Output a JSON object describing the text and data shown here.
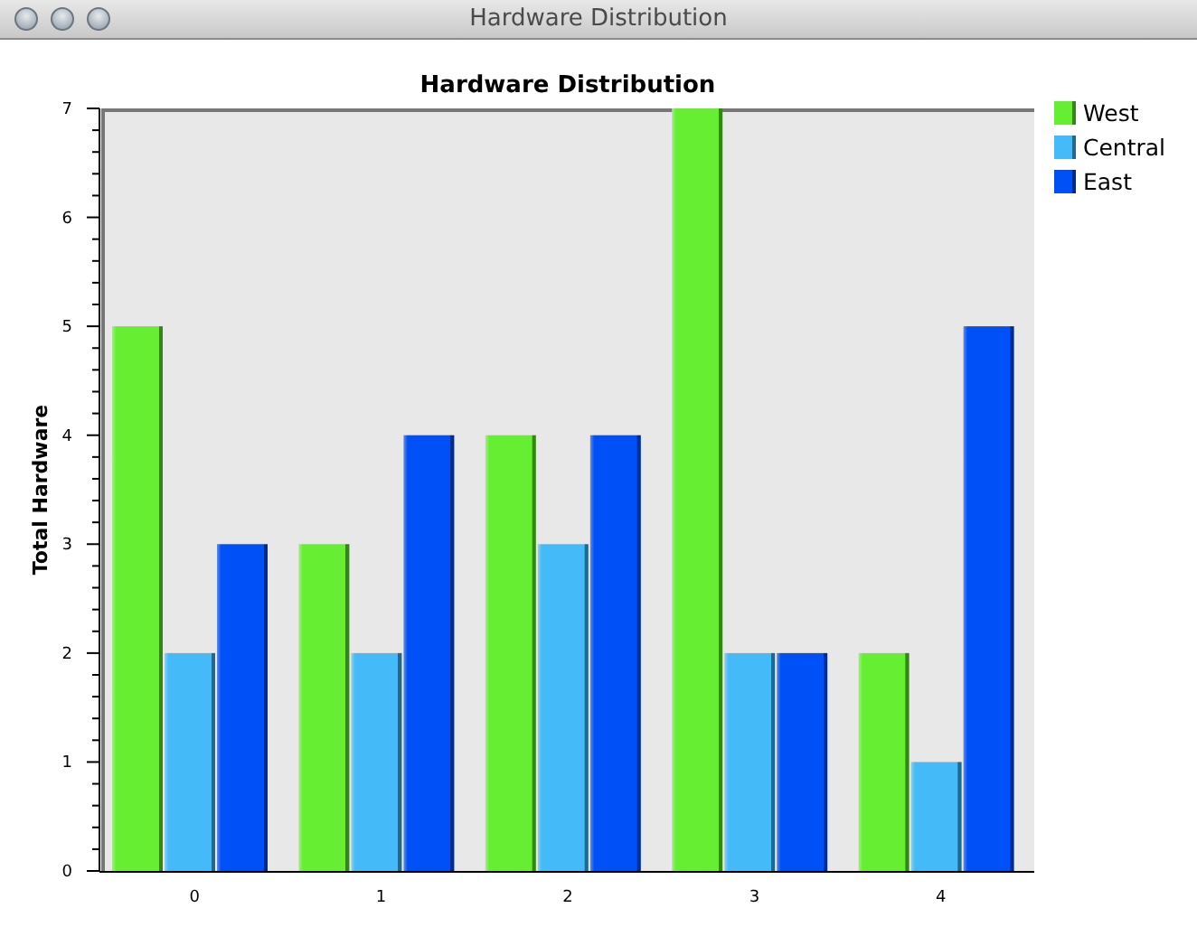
{
  "window": {
    "title": "Hardware Distribution"
  },
  "chart": {
    "chart_data": {
      "type": "bar",
      "title": "Hardware Distribution",
      "ylabel": "Total Hardware",
      "categories": [
        "0",
        "1",
        "2",
        "3",
        "4"
      ],
      "series": [
        {
          "name": "West",
          "color": "#66ee33",
          "values": [
            5,
            3,
            4,
            7,
            2
          ]
        },
        {
          "name": "Central",
          "color": "#44bbf8",
          "values": [
            2,
            2,
            3,
            2,
            1
          ]
        },
        {
          "name": "East",
          "color": "#0050f8",
          "values": [
            3,
            4,
            4,
            2,
            5
          ]
        }
      ],
      "legend": true,
      "ylim": [
        0,
        7
      ],
      "yticks": [
        0,
        1,
        2,
        3,
        4,
        5,
        6,
        7
      ]
    }
  }
}
